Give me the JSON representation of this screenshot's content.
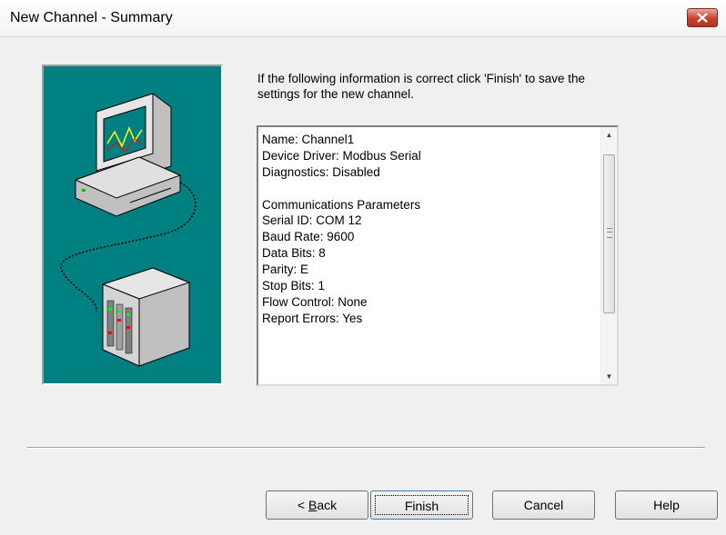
{
  "window": {
    "title": "New Channel - Summary",
    "close_icon": "close-icon"
  },
  "instruction": "If the following information is correct click 'Finish' to save the settings for the new channel.",
  "summary": {
    "lines": [
      "Name: Channel1",
      "Device Driver: Modbus Serial",
      "Diagnostics: Disabled",
      "",
      "Communications Parameters",
      "Serial ID: COM 12",
      "Baud Rate: 9600",
      "Data Bits: 8",
      "Parity: E",
      "Stop Bits: 1",
      "Flow Control: None",
      "Report Errors: Yes"
    ]
  },
  "buttons": {
    "back_prefix": "< ",
    "back_accel": "B",
    "back_rest": "ack",
    "finish": "Finish",
    "cancel": "Cancel",
    "help": "Help"
  },
  "colors": {
    "art_background": "#008080",
    "close_button": "#c7402d"
  }
}
